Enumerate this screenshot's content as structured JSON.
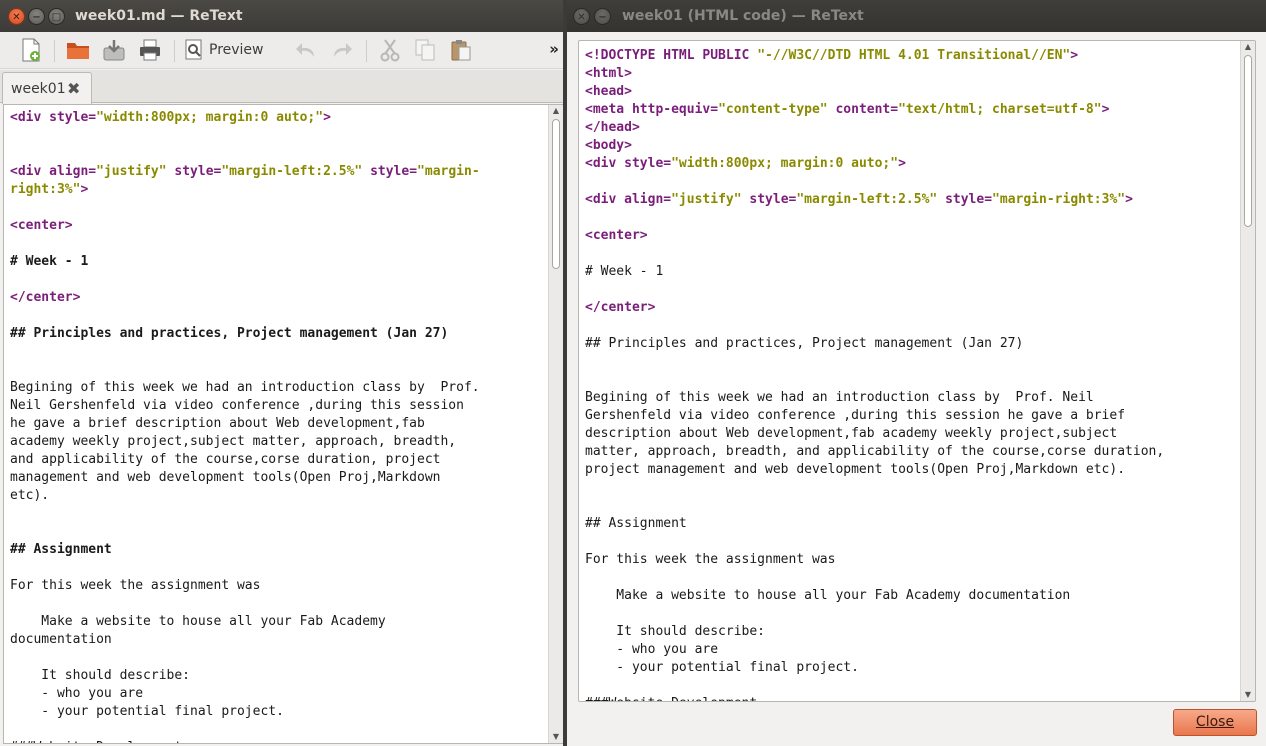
{
  "left_window": {
    "title": "week01.md — ReText",
    "toolbar": {
      "preview_label": "Preview",
      "overflow": "»"
    },
    "tab": {
      "label": "week01",
      "close": "✖"
    },
    "editor_lines": [
      [
        {
          "t": "<div ",
          "c": "tag"
        },
        {
          "t": "style=",
          "c": "attr"
        },
        {
          "t": "\"width:800px; margin:0 auto;\"",
          "c": "str"
        },
        {
          "t": ">",
          "c": "tag"
        }
      ],
      [],
      [],
      [
        {
          "t": "<div ",
          "c": "tag"
        },
        {
          "t": "align=",
          "c": "attr"
        },
        {
          "t": "\"justify\" ",
          "c": "str"
        },
        {
          "t": "style=",
          "c": "attr"
        },
        {
          "t": "\"margin-left:2.5%\" ",
          "c": "str"
        },
        {
          "t": "style=",
          "c": "attr"
        },
        {
          "t": "\"margin-",
          "c": "str"
        }
      ],
      [
        {
          "t": "right:3%\"",
          "c": "str"
        },
        {
          "t": ">",
          "c": "tag"
        }
      ],
      [],
      [
        {
          "t": "<center>",
          "c": "tag"
        }
      ],
      [],
      [
        {
          "t": "# Week - 1",
          "c": "hdr"
        }
      ],
      [],
      [
        {
          "t": "</center>",
          "c": "tag"
        }
      ],
      [],
      [
        {
          "t": "## Principles and practices, Project management (Jan 27)",
          "c": "hdr"
        }
      ],
      [],
      [],
      [
        {
          "t": "Begining of this week we had an introduction class by  Prof."
        }
      ],
      [
        {
          "t": "Neil Gershenfeld via video conference ,during this session"
        }
      ],
      [
        {
          "t": "he gave a brief description about Web development,fab"
        }
      ],
      [
        {
          "t": "academy weekly project,subject matter, approach, breadth,"
        }
      ],
      [
        {
          "t": "and applicability of the course,corse duration, project"
        }
      ],
      [
        {
          "t": "management and web development tools(Open Proj,Markdown"
        }
      ],
      [
        {
          "t": "etc)."
        }
      ],
      [],
      [],
      [
        {
          "t": "## Assignment",
          "c": "hdr"
        }
      ],
      [],
      [
        {
          "t": "For this week the assignment was"
        }
      ],
      [],
      [
        {
          "t": "    Make a website to house all your Fab Academy"
        }
      ],
      [
        {
          "t": "documentation"
        }
      ],
      [],
      [
        {
          "t": "    It should describe:"
        }
      ],
      [
        {
          "t": "    - who you are"
        }
      ],
      [
        {
          "t": "    - your potential final project."
        }
      ],
      [],
      [
        {
          "t": "###Website Development"
        }
      ]
    ]
  },
  "right_window": {
    "title": "week01 (HTML code) — ReText",
    "close_button": "Close",
    "code_lines": [
      [
        {
          "t": "<!DOCTYPE HTML PUBLIC ",
          "c": "tag"
        },
        {
          "t": "\"-//W3C//DTD HTML 4.01 Transitional//EN\"",
          "c": "str"
        },
        {
          "t": ">",
          "c": "tag"
        }
      ],
      [
        {
          "t": "<html>",
          "c": "tag"
        }
      ],
      [
        {
          "t": "<head>",
          "c": "tag"
        }
      ],
      [
        {
          "t": "<meta ",
          "c": "tag"
        },
        {
          "t": "http-equiv=",
          "c": "attr"
        },
        {
          "t": "\"content-type\" ",
          "c": "str"
        },
        {
          "t": "content=",
          "c": "attr"
        },
        {
          "t": "\"text/html; charset=utf-8\"",
          "c": "str"
        },
        {
          "t": ">",
          "c": "tag"
        }
      ],
      [
        {
          "t": "</head>",
          "c": "tag"
        }
      ],
      [
        {
          "t": "<body>",
          "c": "tag"
        }
      ],
      [
        {
          "t": "<div ",
          "c": "tag"
        },
        {
          "t": "style=",
          "c": "attr"
        },
        {
          "t": "\"width:800px; margin:0 auto;\"",
          "c": "str"
        },
        {
          "t": ">",
          "c": "tag"
        }
      ],
      [],
      [
        {
          "t": "<div ",
          "c": "tag"
        },
        {
          "t": "align=",
          "c": "attr"
        },
        {
          "t": "\"justify\" ",
          "c": "str"
        },
        {
          "t": "style=",
          "c": "attr"
        },
        {
          "t": "\"margin-left:2.5%\" ",
          "c": "str"
        },
        {
          "t": "style=",
          "c": "attr"
        },
        {
          "t": "\"margin-right:3%\"",
          "c": "str"
        },
        {
          "t": ">",
          "c": "tag"
        }
      ],
      [],
      [
        {
          "t": "<center>",
          "c": "tag"
        }
      ],
      [],
      [
        {
          "t": "# Week - 1"
        }
      ],
      [],
      [
        {
          "t": "</center>",
          "c": "tag"
        }
      ],
      [],
      [
        {
          "t": "## Principles and practices, Project management (Jan 27)"
        }
      ],
      [],
      [],
      [
        {
          "t": "Begining of this week we had an introduction class by  Prof. Neil"
        }
      ],
      [
        {
          "t": "Gershenfeld via video conference ,during this session he gave a brief"
        }
      ],
      [
        {
          "t": "description about Web development,fab academy weekly project,subject"
        }
      ],
      [
        {
          "t": "matter, approach, breadth, and applicability of the course,corse duration,"
        }
      ],
      [
        {
          "t": "project management and web development tools(Open Proj,Markdown etc)."
        }
      ],
      [],
      [],
      [
        {
          "t": "## Assignment"
        }
      ],
      [],
      [
        {
          "t": "For this week the assignment was"
        }
      ],
      [],
      [
        {
          "t": "    Make a website to house all your Fab Academy documentation"
        }
      ],
      [],
      [
        {
          "t": "    It should describe:"
        }
      ],
      [
        {
          "t": "    - who you are"
        }
      ],
      [
        {
          "t": "    - your potential final project."
        }
      ],
      [],
      [
        {
          "t": "###Website Development"
        }
      ]
    ]
  },
  "icons": [
    "new-file-icon",
    "open-folder-icon",
    "save-icon",
    "print-icon",
    "preview-icon",
    "undo-icon",
    "redo-icon",
    "cut-icon",
    "copy-icon",
    "paste-icon"
  ],
  "colors": {
    "tag": "#7a1e7a",
    "string": "#8a8a00",
    "close_accent": "#e9774e"
  }
}
